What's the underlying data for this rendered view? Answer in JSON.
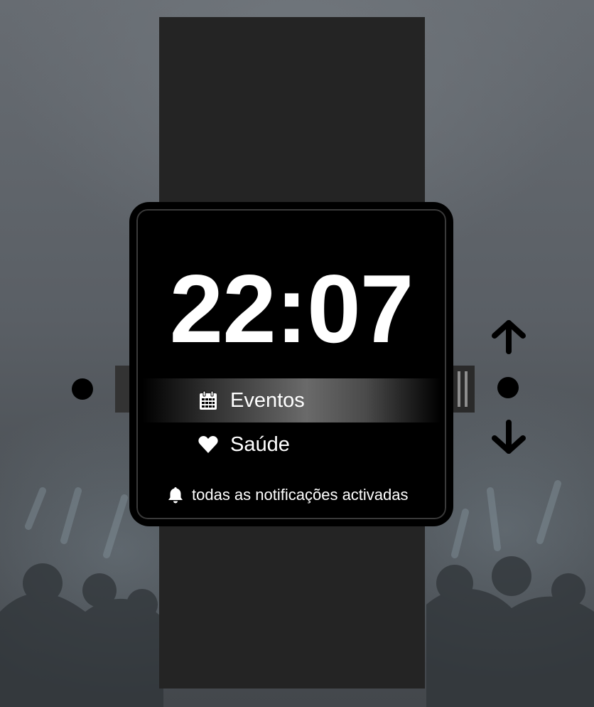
{
  "watch": {
    "time": "22:07",
    "menu": [
      {
        "label": "Eventos",
        "icon": "calendar-icon",
        "selected": true
      },
      {
        "label": "Saúde",
        "icon": "heart-icon",
        "selected": false
      }
    ],
    "notification": {
      "icon": "bell-icon",
      "label": "todas as notificações activadas"
    }
  },
  "controls": {
    "left_button": "dot-button",
    "right_button": "dot-button",
    "scroll_up": "arrow-up-icon",
    "scroll_down": "arrow-down-icon"
  },
  "colors": {
    "screen": "#000000",
    "strap": "#242424",
    "text": "#ffffff"
  }
}
